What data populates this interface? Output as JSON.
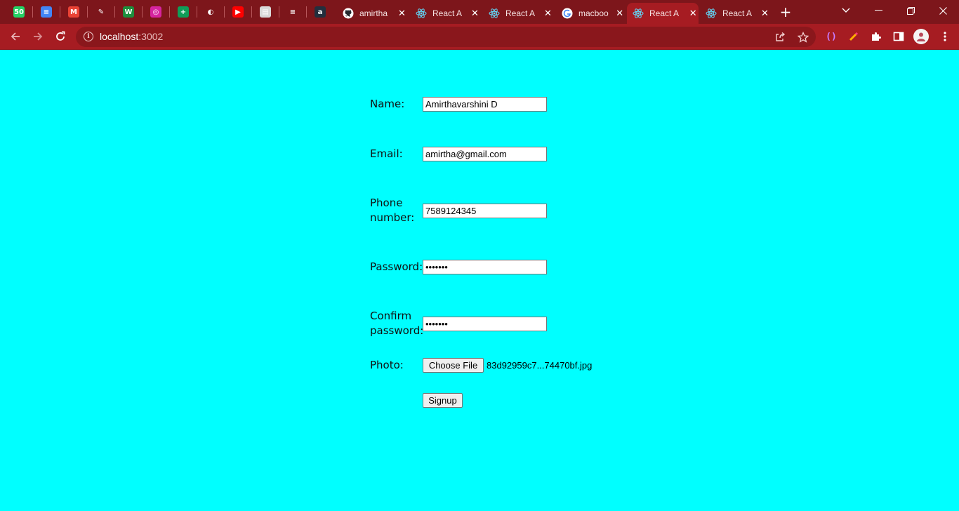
{
  "browser": {
    "pinned_tabs": [
      {
        "icon": "whatsapp-icon",
        "glyph": "50",
        "color": "#25d366"
      },
      {
        "icon": "google-docs-icon",
        "glyph": "≡",
        "color": "#4285f4"
      },
      {
        "icon": "gmail-icon",
        "glyph": "M",
        "color": "#ea4335"
      },
      {
        "icon": "quill-pen-icon",
        "glyph": "✎",
        "color": "#7d161b"
      },
      {
        "icon": "w-logo-icon",
        "glyph": "W",
        "color": "#1e8e3e"
      },
      {
        "icon": "instagram-icon",
        "glyph": "◎",
        "color": "#d6249f"
      },
      {
        "icon": "google-sheets-icon",
        "glyph": "+",
        "color": "#0f9d58"
      },
      {
        "icon": "globe-icon",
        "glyph": "◐",
        "color": "#7d161b"
      },
      {
        "icon": "youtube-icon",
        "glyph": "▶",
        "color": "#ff0000"
      },
      {
        "icon": "notepad-icon",
        "glyph": "▤",
        "color": "#d8d8d8"
      },
      {
        "icon": "dash-logo-icon",
        "glyph": "≡",
        "color": "#7d161b"
      },
      {
        "icon": "amazon-icon",
        "glyph": "a",
        "color": "#232f3e"
      }
    ],
    "tabs": [
      {
        "title": "amirtha",
        "icon": "github-icon",
        "active": false
      },
      {
        "title": "React A",
        "icon": "react-icon",
        "active": false
      },
      {
        "title": "React A",
        "icon": "react-icon",
        "active": false
      },
      {
        "title": "macboo",
        "icon": "google-icon",
        "active": false
      },
      {
        "title": "React A",
        "icon": "react-icon",
        "active": true
      },
      {
        "title": "React A",
        "icon": "react-icon",
        "active": false
      }
    ],
    "address": {
      "host": "localhost",
      "port": ":3002"
    }
  },
  "form": {
    "name_label": "Name:",
    "name_value": "Amirthavarshini D",
    "email_label": "Email:",
    "email_value": "amirtha@gmail.com",
    "phone_label_line1": "Phone",
    "phone_label_line2": "number:",
    "phone_value": "7589124345",
    "password_label": "Password:",
    "password_value": "•••••••",
    "confirm_label_line1": "Confirm",
    "confirm_label_line2": "password:",
    "confirm_value": "•••••••",
    "photo_label": "Photo:",
    "choose_file_label": "Choose File",
    "file_name": "83d92959c7...74470bf.jpg",
    "signup_label": "Signup"
  },
  "colors": {
    "page_background": "#00ffff",
    "tab_strip": "#7d161b",
    "toolbar": "#a61c22"
  }
}
